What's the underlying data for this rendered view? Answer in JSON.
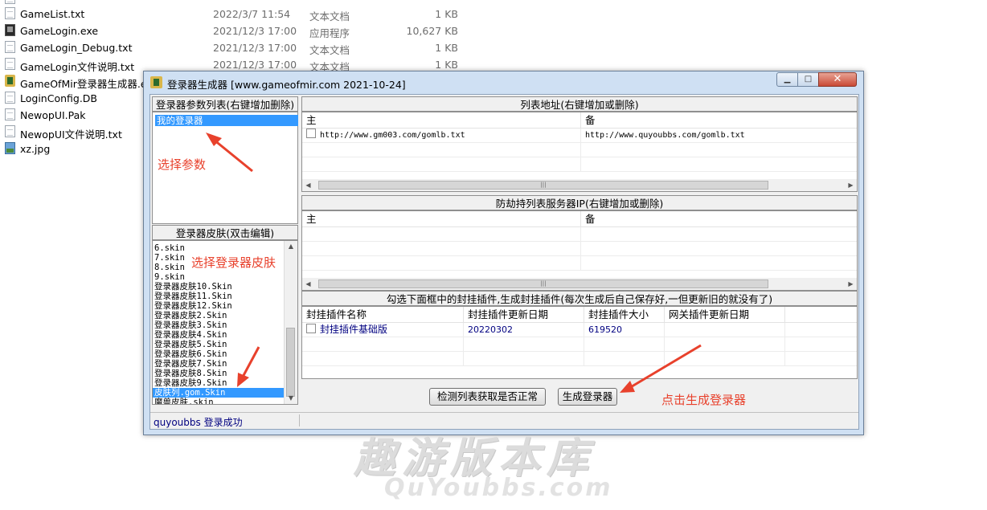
{
  "explorer": {
    "files": [
      {
        "name": "GameList.txt",
        "date": "2022/3/7 11:54",
        "type": "文本文档",
        "size": "1 KB",
        "icon": "txt"
      },
      {
        "name": "GameLogin.exe",
        "date": "2021/12/3 17:00",
        "type": "应用程序",
        "size": "10,627 KB",
        "icon": "exe"
      },
      {
        "name": "GameLogin_Debug.txt",
        "date": "2021/12/3 17:00",
        "type": "文本文档",
        "size": "1 KB",
        "icon": "txt"
      },
      {
        "name": "GameLogin文件说明.txt",
        "date": "2021/12/3 17:00",
        "type": "文本文档",
        "size": "1 KB",
        "icon": "txt"
      },
      {
        "name": "GameOfMir登录器生成器.exe",
        "date": "",
        "type": "",
        "size": "",
        "icon": "gen"
      },
      {
        "name": "LoginConfig.DB",
        "date": "",
        "type": "",
        "size": "",
        "icon": "txt"
      },
      {
        "name": "NewopUI.Pak",
        "date": "",
        "type": "",
        "size": "",
        "icon": "txt"
      },
      {
        "name": "NewopUI文件说明.txt",
        "date": "",
        "type": "",
        "size": "",
        "icon": "txt"
      },
      {
        "name": "xz.jpg",
        "date": "",
        "type": "",
        "size": "",
        "icon": "jpg"
      }
    ]
  },
  "window": {
    "title": "登录器生成器 [www.gameofmir.com 2021-10-24]",
    "min_symbol": "▁",
    "max_symbol": "□",
    "close_symbol": "✕"
  },
  "left": {
    "params_title": "登录器参数列表(右键增加删除)",
    "params_items": [
      "我的登录器"
    ],
    "skins_title": "登录器皮肤(双击编辑)",
    "skins": [
      "6.skin",
      "7.skin",
      "8.skin",
      "9.skin",
      "登录器皮肤10.Skin",
      "登录器皮肤11.Skin",
      "登录器皮肤12.Skin",
      "登录器皮肤2.Skin",
      "登录器皮肤3.Skin",
      "登录器皮肤4.Skin",
      "登录器皮肤5.Skin",
      "登录器皮肤6.Skin",
      "登录器皮肤7.Skin",
      "登录器皮肤8.Skin",
      "登录器皮肤9.Skin",
      "皮肤列.gom.Skin",
      "魔兽皮肤.skin"
    ],
    "selected_skin_index": 15
  },
  "list_addr": {
    "title": "列表地址(右键增加或删除)",
    "col_main": "主",
    "col_backup": "备",
    "rows": [
      {
        "main": "http://www.gm003.com/gomlb.txt",
        "backup": "http://www.quyoubbs.com/gomlb.txt"
      }
    ]
  },
  "anti_hijack": {
    "title": "防劫持列表服务器IP(右键增加或删除)",
    "col_main": "主",
    "col_backup": "备"
  },
  "plugins": {
    "title": "勾选下面框中的封挂插件,生成封挂插件(每次生成后自己保存好,一但更新旧的就没有了)",
    "columns": [
      "封挂插件名称",
      "封挂插件更新日期",
      "封挂插件大小",
      "网关插件更新日期"
    ],
    "rows": [
      {
        "name": "封挂插件基础版",
        "date": "20220302",
        "size": "619520",
        "gw_date": ""
      }
    ]
  },
  "buttons": {
    "check": "检测列表获取是否正常",
    "generate": "生成登录器"
  },
  "status": {
    "text": "quyoubbs 登录成功"
  },
  "annotations": {
    "select_params": "选择参数",
    "select_skin": "选择登录器皮肤",
    "click_generate": "点击生成登录器",
    "color": "#e8412c"
  },
  "watermark": {
    "cn": "趣游版本库",
    "en": "QuYoubbs.com"
  }
}
